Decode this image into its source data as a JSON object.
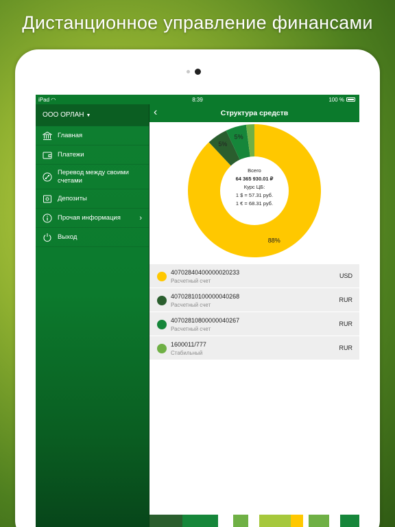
{
  "promo": {
    "title": "Дистанционное управление финансами"
  },
  "status_bar": {
    "carrier": "iPad",
    "time": "8:39",
    "battery": "100 %"
  },
  "sidebar": {
    "org_name": "ООО ОРЛАН",
    "items": [
      {
        "label": "Главная",
        "icon": "bank-icon"
      },
      {
        "label": "Платежи",
        "icon": "wallet-icon"
      },
      {
        "label": "Перевод между своими счетами",
        "icon": "transfer-icon"
      },
      {
        "label": "Депозиты",
        "icon": "safe-icon"
      },
      {
        "label": "Прочая информация",
        "icon": "info-icon"
      },
      {
        "label": "Выход",
        "icon": "power-icon"
      }
    ]
  },
  "header": {
    "title": "Структура средств"
  },
  "donut": {
    "total_label": "Всего",
    "total_value": "64 365 930.01 ₽",
    "rate_label": "Курс ЦБ:",
    "usd_rate": "1 $ = 57.31 руб.",
    "eur_rate": "1 € = 68.31 руб."
  },
  "chart_data": {
    "type": "pie",
    "slices": [
      {
        "label": "88%",
        "value": 88,
        "color": "#ffc800"
      },
      {
        "label": "5%",
        "value": 5,
        "color": "#2a5e2e"
      },
      {
        "label": "5%",
        "value": 5,
        "color": "#16863a"
      },
      {
        "label": "",
        "value": 2,
        "color": "#6fb045"
      }
    ]
  },
  "accounts": [
    {
      "number": "40702840400000020233",
      "type": "Расчетный счет",
      "currency": "USD",
      "color": "#ffc800"
    },
    {
      "number": "40702810100000040268",
      "type": "Расчетный счет",
      "currency": "RUR",
      "color": "#2a5e2e"
    },
    {
      "number": "40702810800000040267",
      "type": "Расчетный счет",
      "currency": "RUR",
      "color": "#16863a"
    },
    {
      "number": "1600011/777",
      "type": "Стабильный",
      "currency": "RUR",
      "color": "#6fb045"
    }
  ]
}
